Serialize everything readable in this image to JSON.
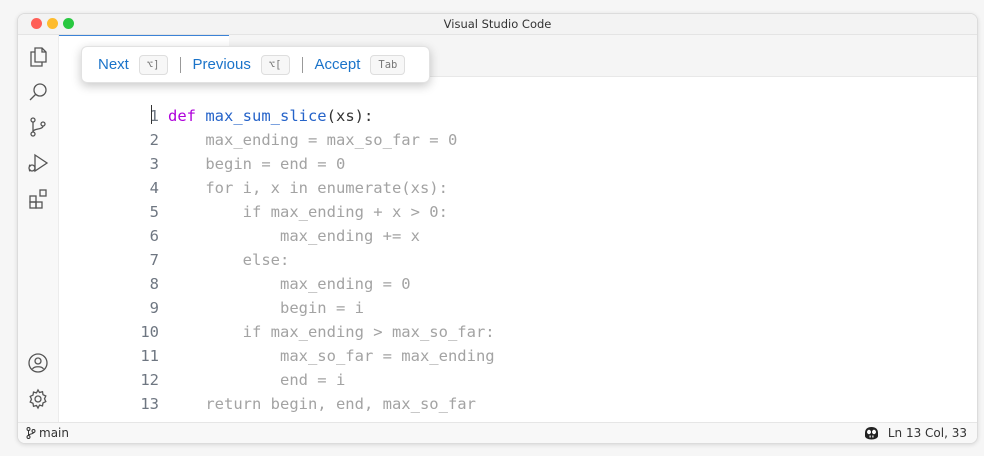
{
  "window": {
    "title": "Visual Studio Code"
  },
  "popup": {
    "next_label": "Next",
    "next_shortcut": "⌥]",
    "previous_label": "Previous",
    "previous_shortcut": "⌥[",
    "accept_label": "Accept",
    "accept_shortcut": "Tab"
  },
  "editor": {
    "lines": [
      {
        "num": "1",
        "text": ""
      },
      {
        "num": "2",
        "text": "    max_ending = max_so_far = 0"
      },
      {
        "num": "3",
        "text": "    begin = end = 0"
      },
      {
        "num": "4",
        "text": "    for i, x in enumerate(xs):"
      },
      {
        "num": "5",
        "text": "        if max_ending + x > 0:"
      },
      {
        "num": "6",
        "text": "            max_ending += x"
      },
      {
        "num": "7",
        "text": "        else:"
      },
      {
        "num": "8",
        "text": "            max_ending = 0"
      },
      {
        "num": "9",
        "text": "            begin = i"
      },
      {
        "num": "10",
        "text": "        if max_ending > max_so_far:"
      },
      {
        "num": "11",
        "text": "            max_so_far = max_ending"
      },
      {
        "num": "12",
        "text": "            end = i"
      },
      {
        "num": "13",
        "text": "    return begin, end, max_so_far"
      }
    ],
    "line1_keyword": "def ",
    "line1_function": "max_sum_slice",
    "line1_params": "(xs):"
  },
  "statusbar": {
    "branch": "main",
    "position": "Ln 13 Col, 33"
  },
  "activity_icons": [
    "files-icon",
    "search-icon",
    "source-control-icon",
    "run-debug-icon",
    "extensions-icon",
    "account-icon",
    "settings-gear-icon"
  ],
  "colors": {
    "accent": "#1a73c9",
    "keyword": "#af00db",
    "function": "#2563c9",
    "ghost_text": "#a3a3a3"
  }
}
